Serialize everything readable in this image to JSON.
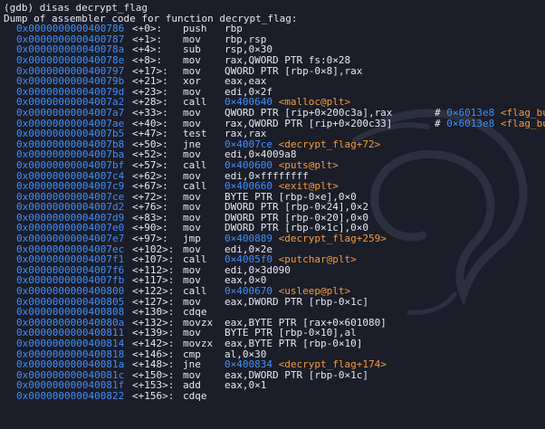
{
  "terminal": {
    "prompt": "(gdb) disas decrypt_flag",
    "header": "Dump of assembler code for function decrypt_flag:",
    "colors": {
      "background": "#1b1d28",
      "text": "#e6e8ef",
      "address": "#3d8fff",
      "symbol": "#f59b3c"
    },
    "rows": [
      {
        "addr": "0x0000000000400786",
        "off": "<+0>:",
        "mn": "push",
        "op": "rbp"
      },
      {
        "addr": "0x0000000000400787",
        "off": "<+1>:",
        "mn": "mov",
        "op": "rbp,rsp"
      },
      {
        "addr": "0x000000000040078a",
        "off": "<+4>:",
        "mn": "sub",
        "op": "rsp,0×30"
      },
      {
        "addr": "0x000000000040078e",
        "off": "<+8>:",
        "mn": "mov",
        "op": "rax,QWORD PTR fs:0×28"
      },
      {
        "addr": "0x0000000000400797",
        "off": "<+17>:",
        "mn": "mov",
        "op": "QWORD PTR [rbp-0×8],rax"
      },
      {
        "addr": "0x000000000040079b",
        "off": "<+21>:",
        "mn": "xor",
        "op": "eax,eax"
      },
      {
        "addr": "0x000000000040079d",
        "off": "<+23>:",
        "mn": "mov",
        "op": "edi,0×2f"
      },
      {
        "addr": "0x00000000004007a2",
        "off": "<+28>:",
        "mn": "call",
        "op": "",
        "tgt": "0×400640",
        "sym": "<malloc@plt>"
      },
      {
        "addr": "0x00000000004007a7",
        "off": "<+33>:",
        "mn": "mov",
        "op": "QWORD PTR [rip+0×200c3a],rax",
        "cmt_hash": "# ",
        "cmt_addr": "0×6013e8",
        "cmt_sym": "<flag_buf>"
      },
      {
        "addr": "0x00000000004007ae",
        "off": "<+40>:",
        "mn": "mov",
        "op": "rax,QWORD PTR [rip+0×200c33]",
        "cmt_hash": "# ",
        "cmt_addr": "0×6013e8",
        "cmt_sym": "<flag_buf>"
      },
      {
        "addr": "0x00000000004007b5",
        "off": "<+47>:",
        "mn": "test",
        "op": "rax,rax"
      },
      {
        "addr": "0x00000000004007b8",
        "off": "<+50>:",
        "mn": "jne",
        "op": "",
        "tgt": "0×4007ce",
        "sym": "<decrypt_flag+72>"
      },
      {
        "addr": "0x00000000004007ba",
        "off": "<+52>:",
        "mn": "mov",
        "op": "edi,0×4009a8"
      },
      {
        "addr": "0x00000000004007bf",
        "off": "<+57>:",
        "mn": "call",
        "op": "",
        "tgt": "0×400600",
        "sym": "<puts@plt>"
      },
      {
        "addr": "0x00000000004007c4",
        "off": "<+62>:",
        "mn": "mov",
        "op": "edi,0×ffffffff"
      },
      {
        "addr": "0x00000000004007c9",
        "off": "<+67>:",
        "mn": "call",
        "op": "",
        "tgt": "0×400660",
        "sym": "<exit@plt>"
      },
      {
        "addr": "0x00000000004007ce",
        "off": "<+72>:",
        "mn": "mov",
        "op": "BYTE PTR [rbp-0×e],0×0"
      },
      {
        "addr": "0x00000000004007d2",
        "off": "<+76>:",
        "mn": "mov",
        "op": "DWORD PTR [rbp-0×24],0×2"
      },
      {
        "addr": "0x00000000004007d9",
        "off": "<+83>:",
        "mn": "mov",
        "op": "DWORD PTR [rbp-0×20],0×0"
      },
      {
        "addr": "0x00000000004007e0",
        "off": "<+90>:",
        "mn": "mov",
        "op": "DWORD PTR [rbp-0×1c],0×0"
      },
      {
        "addr": "0x00000000004007e7",
        "off": "<+97>:",
        "mn": "jmp",
        "op": "",
        "tgt": "0×400889",
        "sym": "<decrypt_flag+259>"
      },
      {
        "addr": "0x00000000004007ec",
        "off": "<+102>:",
        "mn": "mov",
        "op": "edi,0×2e"
      },
      {
        "addr": "0x00000000004007f1",
        "off": "<+107>:",
        "mn": "call",
        "op": "",
        "tgt": "0×4005f0",
        "sym": "<putchar@plt>"
      },
      {
        "addr": "0x00000000004007f6",
        "off": "<+112>:",
        "mn": "mov",
        "op": "edi,0×3d090"
      },
      {
        "addr": "0x00000000004007fb",
        "off": "<+117>:",
        "mn": "mov",
        "op": "eax,0×0"
      },
      {
        "addr": "0x0000000000400800",
        "off": "<+122>:",
        "mn": "call",
        "op": "",
        "tgt": "0×400670",
        "sym": "<usleep@plt>"
      },
      {
        "addr": "0x0000000000400805",
        "off": "<+127>:",
        "mn": "mov",
        "op": "eax,DWORD PTR [rbp-0×1c]"
      },
      {
        "addr": "0x0000000000400808",
        "off": "<+130>:",
        "mn": "cdqe",
        "op": ""
      },
      {
        "addr": "0x000000000040080a",
        "off": "<+132>:",
        "mn": "movzx",
        "op": "eax,BYTE PTR [rax+0×601080]"
      },
      {
        "addr": "0x0000000000400811",
        "off": "<+139>:",
        "mn": "mov",
        "op": "BYTE PTR [rbp-0×10],al"
      },
      {
        "addr": "0x0000000000400814",
        "off": "<+142>:",
        "mn": "movzx",
        "op": "eax,BYTE PTR [rbp-0×10]"
      },
      {
        "addr": "0x0000000000400818",
        "off": "<+146>:",
        "mn": "cmp",
        "op": "al,0×30"
      },
      {
        "addr": "0x000000000040081a",
        "off": "<+148>:",
        "mn": "jne",
        "op": "",
        "tgt": "0×400834",
        "sym": "<decrypt_flag+174>"
      },
      {
        "addr": "0x000000000040081c",
        "off": "<+150>:",
        "mn": "mov",
        "op": "eax,DWORD PTR [rbp-0×1c]"
      },
      {
        "addr": "0x000000000040081f",
        "off": "<+153>:",
        "mn": "add",
        "op": "eax,0×1"
      },
      {
        "addr": "0x0000000000400822",
        "off": "<+156>:",
        "mn": "cdqe",
        "op": ""
      }
    ]
  }
}
